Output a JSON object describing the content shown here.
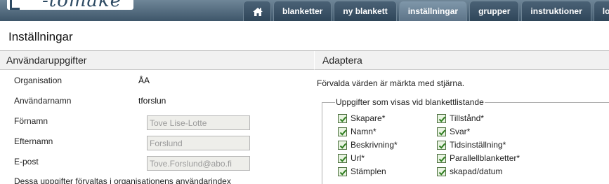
{
  "header": {
    "logo_text": "-tomake",
    "tabs": [
      {
        "label": "blanketter"
      },
      {
        "label": "ny blankett"
      },
      {
        "label": "inställningar",
        "active": true
      },
      {
        "label": "grupper"
      },
      {
        "label": "instruktioner"
      },
      {
        "label": "logga u"
      }
    ],
    "home_icon": "home-icon"
  },
  "page": {
    "title": "Inställningar"
  },
  "user_section": {
    "heading": "Användaruppgifter",
    "fields": [
      {
        "label": "Organisation",
        "value": "ÅA"
      },
      {
        "label": "Användarnamn",
        "value": "tforslun"
      },
      {
        "label": "Förnamn",
        "value": "Tove Lise-Lotte"
      },
      {
        "label": "Efternamn",
        "value": "Forslund"
      },
      {
        "label": "E-post",
        "value": "Tove.Forslund@abo.fi"
      }
    ],
    "note": "Dessa uppgifter förvaltas i organisationens användarindex"
  },
  "adapt_section": {
    "heading": "Adaptera",
    "intro": "Förvalda värden är märkta med stjärna.",
    "legend": "Uppgifter som visas vid blankettlistande",
    "options": [
      {
        "label": "Skapare*",
        "checked": true
      },
      {
        "label": "Tillstånd*",
        "checked": true
      },
      {
        "label": "Namn*",
        "checked": true
      },
      {
        "label": "Svar*",
        "checked": true
      },
      {
        "label": "Beskrivning*",
        "checked": true
      },
      {
        "label": "Tidsinställning*",
        "checked": true
      },
      {
        "label": "Url*",
        "checked": true
      },
      {
        "label": "Parallellblanketter*",
        "checked": true
      },
      {
        "label": "Stämplen",
        "checked": true
      },
      {
        "label": "skapad/datum",
        "checked": true
      }
    ]
  },
  "colors": {
    "header": "#3e566a",
    "active_tab": "#6f879a",
    "checkbox": "#2e7d1f"
  }
}
